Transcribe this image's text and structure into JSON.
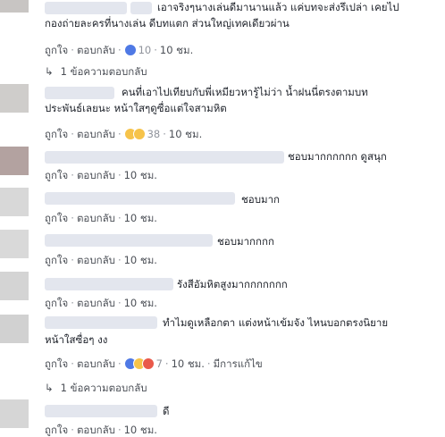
{
  "labels": {
    "like": "ถูกใจ",
    "reply": "ตอบกลับ",
    "sep": "·"
  },
  "comments": [
    {
      "text_lines": [
        "เอาจริงๆนางเล่นดีมานานแล้ว แค่บทจะส่งรึเปล่า เคยไป",
        "กองถ่ายละครที่นางเล่น ดีบทแตก ส่วนใหญ่เทคเดียวผ่าน"
      ],
      "reaction_count": "10",
      "reactions": [
        "like"
      ],
      "time": "10 ชม.",
      "replies_label": "1 ข้อความตอบกลับ"
    },
    {
      "text_lines": [
        "คนที่เอาไปเทียบกับพี่เหมียวหารู้ไม่ว่า น้ำฝนนี่ตรงตามบท",
        "ประพันธ์เลยนะ หน้าใสๆดูซื่อแต่ใจสามหิต"
      ],
      "reaction_count": "38",
      "reactions": [
        "haha",
        "wow"
      ],
      "time": "10 ชม."
    },
    {
      "text_lines": [
        "ชอบมากกกกกก ดูสนุก"
      ],
      "time": "10 ชม."
    },
    {
      "text_lines": [
        "ชอบมาก"
      ],
      "time": "10 ชม."
    },
    {
      "text_lines": [
        "ชอบมากกกก"
      ],
      "time": "10 ชม."
    },
    {
      "text_lines": [
        "รังสีอัมหิตสูงมากกกกกกก"
      ],
      "time": "10 ชม."
    },
    {
      "text_lines": [
        "ทำไมดูเหลือกตา แต่งหน้าเข้มจัง ไหนบอกตรงนิยาย",
        "หน้าใสซื่อๆ งง"
      ],
      "reaction_count": "7",
      "reactions": [
        "like",
        "haha",
        "angry"
      ],
      "time": "10 ชม.",
      "edited": "มีการแก้ไข",
      "replies_label": "1 ข้อความตอบกลับ"
    },
    {
      "text_lines": [
        "ดี"
      ],
      "time": "10 ชม."
    }
  ],
  "colors": {
    "link": "#4b4f56",
    "meta": "#90949c",
    "like_blue": "#4f79e5",
    "haha_yellow": "#f6c34a",
    "angry_red": "#e9594a"
  }
}
